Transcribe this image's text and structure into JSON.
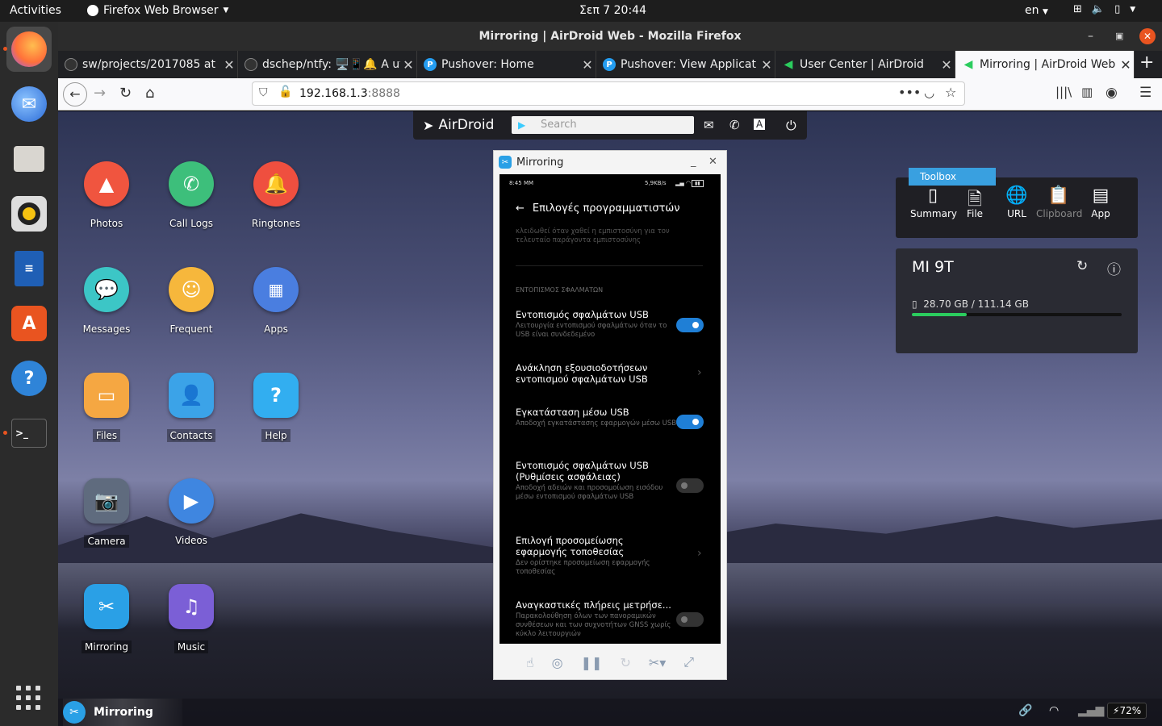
{
  "topbar": {
    "activities": "Activities",
    "app_menu": "Firefox Web Browser",
    "clock": "Σεπ 7  20:44",
    "lang": "en"
  },
  "window": {
    "title": "Mirroring | AirDroid Web - Mozilla Firefox"
  },
  "tabs": [
    {
      "title": "sw/projects/2017085 at",
      "favicon": "github-icon",
      "color": "#333333"
    },
    {
      "title": "dschep/ntfy: 🖥️📱🔔 A ut",
      "favicon": "github-icon",
      "color": "#333333"
    },
    {
      "title": "Pushover: Home",
      "favicon": "pushover-icon",
      "color": "#249df1"
    },
    {
      "title": "Pushover: View Applicat",
      "favicon": "pushover-icon",
      "color": "#249df1"
    },
    {
      "title": "User Center | AirDroid",
      "favicon": "airdroid-icon",
      "color": "#2bcc5e"
    },
    {
      "title": "Mirroring | AirDroid Web",
      "favicon": "airdroid-icon",
      "color": "#2bcc5e"
    }
  ],
  "url": {
    "host": "192.168.1.3",
    "port": ":8888"
  },
  "airdroid": {
    "logo": "AirDroid",
    "search_placeholder": "Search"
  },
  "apps": [
    {
      "label": "Photos",
      "icon": "photos-icon",
      "color": "#f0553f"
    },
    {
      "label": "Call Logs",
      "icon": "phone-icon",
      "color": "#3dbf7b"
    },
    {
      "label": "Ringtones",
      "icon": "bell-icon",
      "color": "#ef4f3f"
    },
    {
      "label": "Messages",
      "icon": "chat-icon",
      "color": "#3cc6c6"
    },
    {
      "label": "Frequent",
      "icon": "frequent-icon",
      "color": "#f6b73c"
    },
    {
      "label": "Apps",
      "icon": "grid-icon",
      "color": "#4a7ee0"
    },
    {
      "label": "Files",
      "icon": "folder-icon",
      "color": "#f5a742"
    },
    {
      "label": "Contacts",
      "icon": "contacts-icon",
      "color": "#3ba3e8"
    },
    {
      "label": "Help",
      "icon": "question-icon",
      "color": "#32aef0"
    },
    {
      "label": "Camera",
      "icon": "camera-icon",
      "color": "#5f6b7e"
    },
    {
      "label": "Videos",
      "icon": "play-icon",
      "color": "#3f86e0"
    },
    {
      "label": "Mirroring",
      "icon": "scissors-icon",
      "color": "#2aa0e6"
    },
    {
      "label": "Music",
      "icon": "music-icon",
      "color": "#7b5fd6"
    }
  ],
  "mirroring": {
    "title": "Mirroring",
    "status_time": "8:45 ΜΜ",
    "status_right": "5,9KB/s",
    "header": "Επιλογές προγραμματιστών",
    "top_fade": "κλειδωθεί όταν χαθεί η εμπιστοσύνη για τον τελευταίο παράγοντα εμπιστοσύνης",
    "section": "ΕΝΤΟΠΙΣΜΟΣ ΣΦΑΛΜΑΤΩΝ",
    "items": [
      {
        "title": "Εντοπισμός σφαλμάτων USB",
        "sub": "Λειτουργία εντοπισμού σφαλμάτων όταν το USB είναι συνδεδεμένο",
        "control": "on"
      },
      {
        "title": "Ανάκληση εξουσιοδοτήσεων εντοπισμού σφαλμάτων USB",
        "sub": "",
        "control": "chevron"
      },
      {
        "title": "Εγκατάσταση μέσω USB",
        "sub": "Αποδοχή εγκατάστασης εφαρμογών μέσω USB",
        "control": "on"
      },
      {
        "title": "Εντοπισμός σφαλμάτων USB (Ρυθμίσεις ασφάλειας)",
        "sub": "Αποδοχή αδειών και προσομοίωση εισόδου μέσω εντοπισμού σφαλμάτων USB",
        "control": "off"
      },
      {
        "title": "Επιλογή προσομείωσης εφαρμογής τοποθεσίας",
        "sub": "Δεν ορίστηκε προσομείωση εφαρμογής τοποθεσίας",
        "control": "chevron"
      },
      {
        "title": "Αναγκαστικές πλήρεις μετρήσε...",
        "sub": "Παρακολούθηση όλων των πανοραμικών συνθέσεων και των συχνοτήτων GNSS χωρίς κύκλο λειτουργιών",
        "control": "off"
      }
    ]
  },
  "toolbox": {
    "label": "Toolbox",
    "items": [
      {
        "label": "Summary",
        "icon": "phone-device-icon"
      },
      {
        "label": "File",
        "icon": "file-icon"
      },
      {
        "label": "URL",
        "icon": "globe-icon"
      },
      {
        "label": "Clipboard",
        "icon": "clipboard-icon"
      },
      {
        "label": "App",
        "icon": "app-icon"
      }
    ]
  },
  "device": {
    "name": "MI 9T",
    "storage": "28.70 GB / 111.14 GB",
    "storage_fraction": 0.26
  },
  "taskbar": {
    "mirroring_label": "Mirroring",
    "battery": "72%"
  }
}
